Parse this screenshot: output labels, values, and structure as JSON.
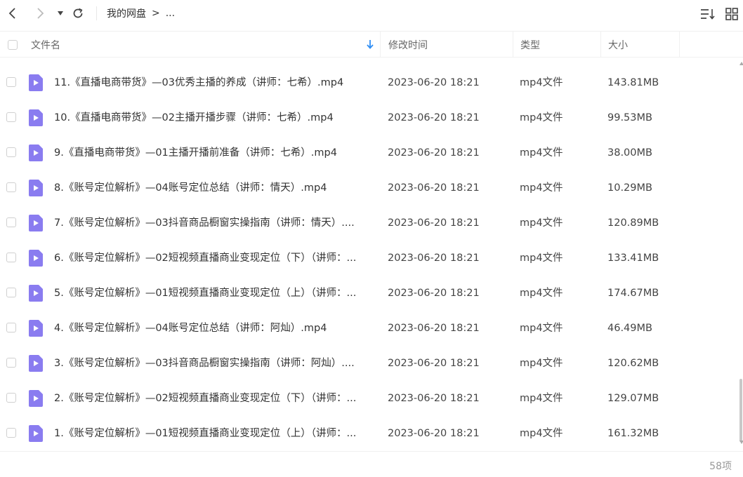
{
  "toolbar": {
    "breadcrumb_root": "我的网盘",
    "breadcrumb_sep": ">",
    "breadcrumb_more": "..."
  },
  "columns": {
    "name": "文件名",
    "modified": "修改时间",
    "type": "类型",
    "size": "大小"
  },
  "files": [
    {
      "name": "11.《直播电商带货》—03优秀主播的养成（讲师：七希）.mp4",
      "modified": "2023-06-20 18:21",
      "type": "mp4文件",
      "size": "143.81MB"
    },
    {
      "name": "10.《直播电商带货》—02主播开播步骤（讲师：七希）.mp4",
      "modified": "2023-06-20 18:21",
      "type": "mp4文件",
      "size": "99.53MB"
    },
    {
      "name": "9.《直播电商带货》—01主播开播前准备（讲师：七希）.mp4",
      "modified": "2023-06-20 18:21",
      "type": "mp4文件",
      "size": "38.00MB"
    },
    {
      "name": "8.《账号定位解析》—04账号定位总结（讲师：情天）.mp4",
      "modified": "2023-06-20 18:21",
      "type": "mp4文件",
      "size": "10.29MB"
    },
    {
      "name": "7.《账号定位解析》—03抖音商品橱窗实操指南（讲师：情天）....",
      "modified": "2023-06-20 18:21",
      "type": "mp4文件",
      "size": "120.89MB"
    },
    {
      "name": "6.《账号定位解析》—02短视频直播商业变现定位（下）（讲师：...",
      "modified": "2023-06-20 18:21",
      "type": "mp4文件",
      "size": "133.41MB"
    },
    {
      "name": "5.《账号定位解析》—01短视频直播商业变现定位（上）（讲师：...",
      "modified": "2023-06-20 18:21",
      "type": "mp4文件",
      "size": "174.67MB"
    },
    {
      "name": "4.《账号定位解析》—04账号定位总结（讲师：阿灿）.mp4",
      "modified": "2023-06-20 18:21",
      "type": "mp4文件",
      "size": "46.49MB"
    },
    {
      "name": "3.《账号定位解析》—03抖音商品橱窗实操指南（讲师：阿灿）....",
      "modified": "2023-06-20 18:21",
      "type": "mp4文件",
      "size": "120.62MB"
    },
    {
      "name": "2.《账号定位解析》—02短视频直播商业变现定位（下）（讲师：...",
      "modified": "2023-06-20 18:21",
      "type": "mp4文件",
      "size": "129.07MB"
    },
    {
      "name": "1.《账号定位解析》—01短视频直播商业变现定位（上）（讲师：...",
      "modified": "2023-06-20 18:21",
      "type": "mp4文件",
      "size": "161.32MB"
    }
  ],
  "footer": {
    "count": "58项"
  },
  "colors": {
    "video_icon": "#8a7cf0",
    "accent": "#2f8ef4",
    "text": "#333333",
    "muted": "#999999"
  },
  "icons": {
    "back": "chevron-left-icon",
    "forward": "chevron-right-icon",
    "history": "caret-down-icon",
    "refresh": "refresh-icon",
    "sort": "sort-list-icon",
    "view": "grid-view-icon",
    "sort_direction": "arrow-down-icon",
    "file": "video-file-icon"
  }
}
